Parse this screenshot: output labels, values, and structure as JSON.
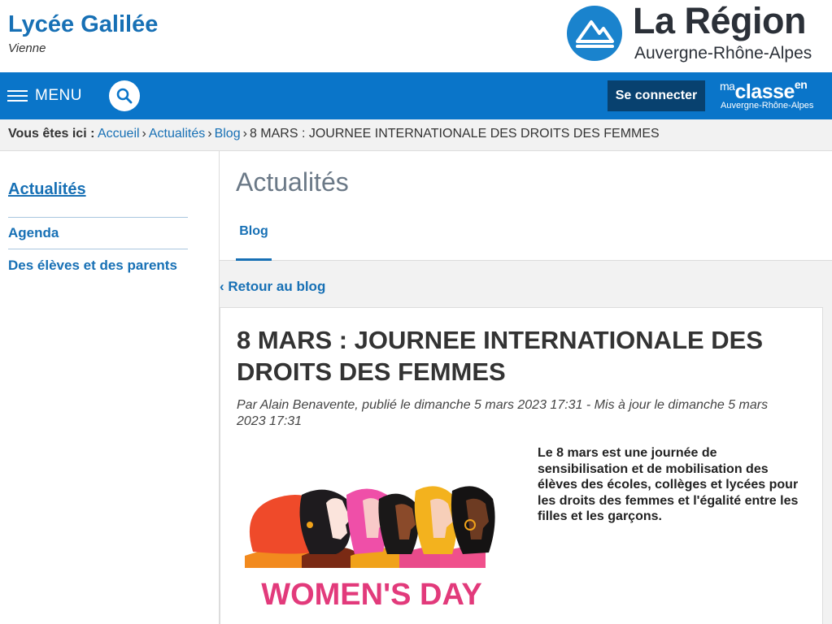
{
  "header": {
    "school_name": "Lycée Galilée",
    "school_city": "Vienne",
    "region_title": "La Région",
    "region_subtitle": "Auvergne-Rhône-Alpes"
  },
  "nav": {
    "menu_label": "MENU",
    "login_label": "Se connecter",
    "maclasse": {
      "ma": "ma",
      "classe": "classe",
      "en": "en",
      "region": "Auvergne-Rhône-Alpes"
    },
    "icons": [
      "menu-icon",
      "search-icon"
    ]
  },
  "breadcrumb": {
    "prefix": "Vous êtes ici :",
    "items": [
      "Accueil",
      "Actualités",
      "Blog"
    ],
    "separator": "›",
    "current": "8 MARS : JOURNEE INTERNATIONALE DES DROITS DES FEMMES"
  },
  "sidebar": {
    "title": "Actualités",
    "items": [
      {
        "label": "Agenda"
      },
      {
        "label": "Des élèves et des parents"
      }
    ]
  },
  "main": {
    "title": "Actualités",
    "tabs": [
      {
        "label": "Blog",
        "active": true
      }
    ],
    "back_link": "‹ Retour au blog"
  },
  "article": {
    "title": "8 MARS : JOURNEE INTERNATIONALE DES DROITS DES FEMMES",
    "meta": "Par Alain Benavente, publié le dimanche 5 mars 2023 17:31 - Mis à jour le dimanche 5 mars 2023 17:31",
    "intro": "Le 8 mars est une journée de sensibilisation et de mobilisation des élèves des écoles, collèges et lycées pour les droits des femmes et l'égalité entre les filles et les garçons.",
    "image_caption": "WOMEN'S DAY"
  },
  "colors": {
    "primary_blue": "#1770b5",
    "nav_blue": "#0a75c9",
    "login_dark": "#08416f",
    "region_circle": "#1a83cd",
    "caption_pink": "#e23a7b"
  }
}
